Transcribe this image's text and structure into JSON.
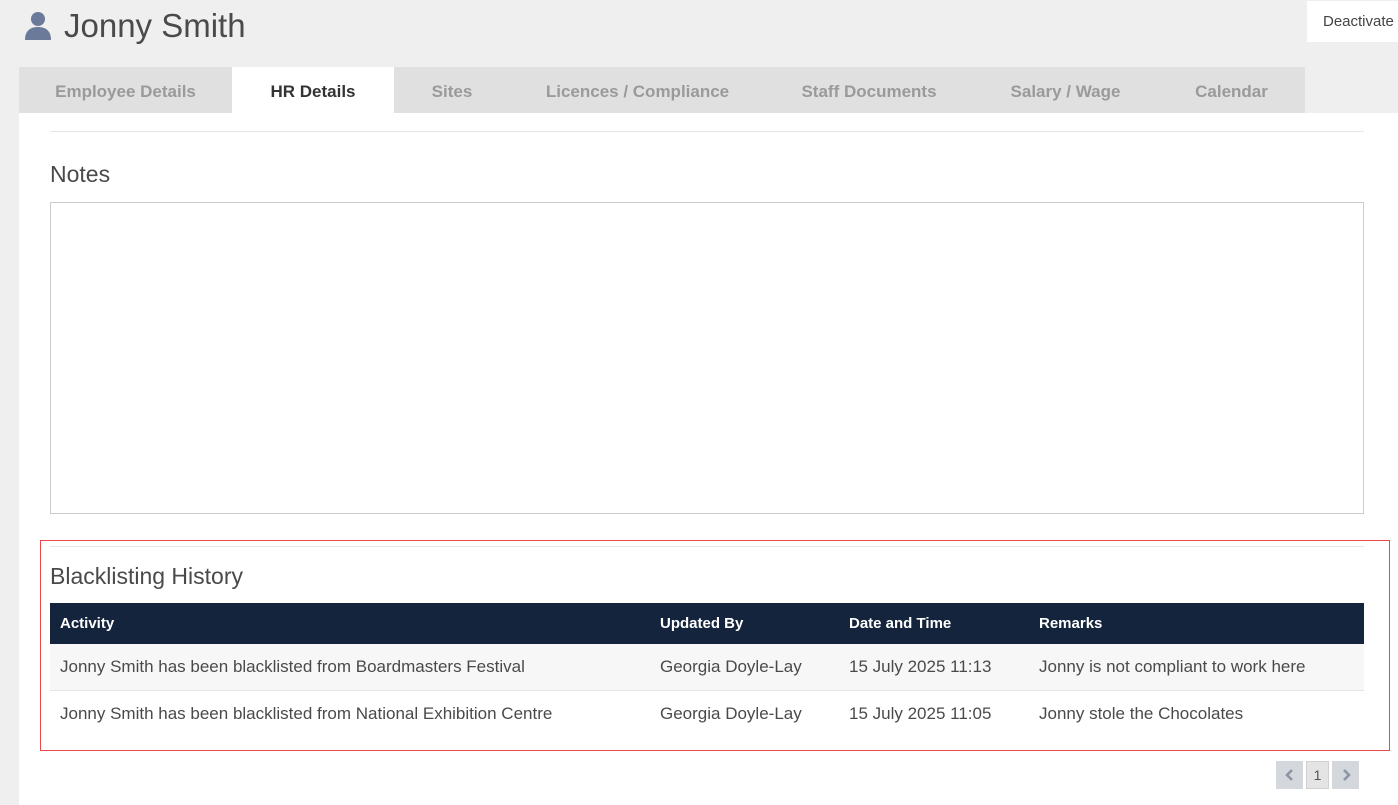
{
  "header": {
    "title": "Jonny Smith",
    "user_icon": "user-icon",
    "deactivate_label": "Deactivate"
  },
  "tabs": [
    {
      "label": "Employee Details",
      "active": false
    },
    {
      "label": "HR Details",
      "active": true
    },
    {
      "label": "Sites",
      "active": false
    },
    {
      "label": "Licences / Compliance",
      "active": false
    },
    {
      "label": "Staff Documents",
      "active": false
    },
    {
      "label": "Salary / Wage",
      "active": false
    },
    {
      "label": "Calendar",
      "active": false
    }
  ],
  "notes": {
    "heading": "Notes",
    "value": ""
  },
  "blacklisting": {
    "heading": "Blacklisting History",
    "columns": [
      "Activity",
      "Updated By",
      "Date and Time",
      "Remarks"
    ],
    "rows": [
      [
        "Jonny Smith has been blacklisted from Boardmasters Festival",
        "Georgia Doyle-Lay",
        "15 July 2025 11:13",
        "Jonny is not compliant to work here"
      ],
      [
        "Jonny Smith has been blacklisted from National Exhibition Centre",
        "Georgia Doyle-Lay",
        "15 July 2025 11:05",
        "Jonny stole the Chocolates"
      ]
    ]
  },
  "pagination": {
    "prev_icon": "chevron-left-icon",
    "current_page": "1",
    "next_icon": "chevron-right-icon"
  },
  "colors": {
    "table_header": "#13243c",
    "highlight_border": "#e8494d",
    "user_icon": "#6b7a99"
  }
}
